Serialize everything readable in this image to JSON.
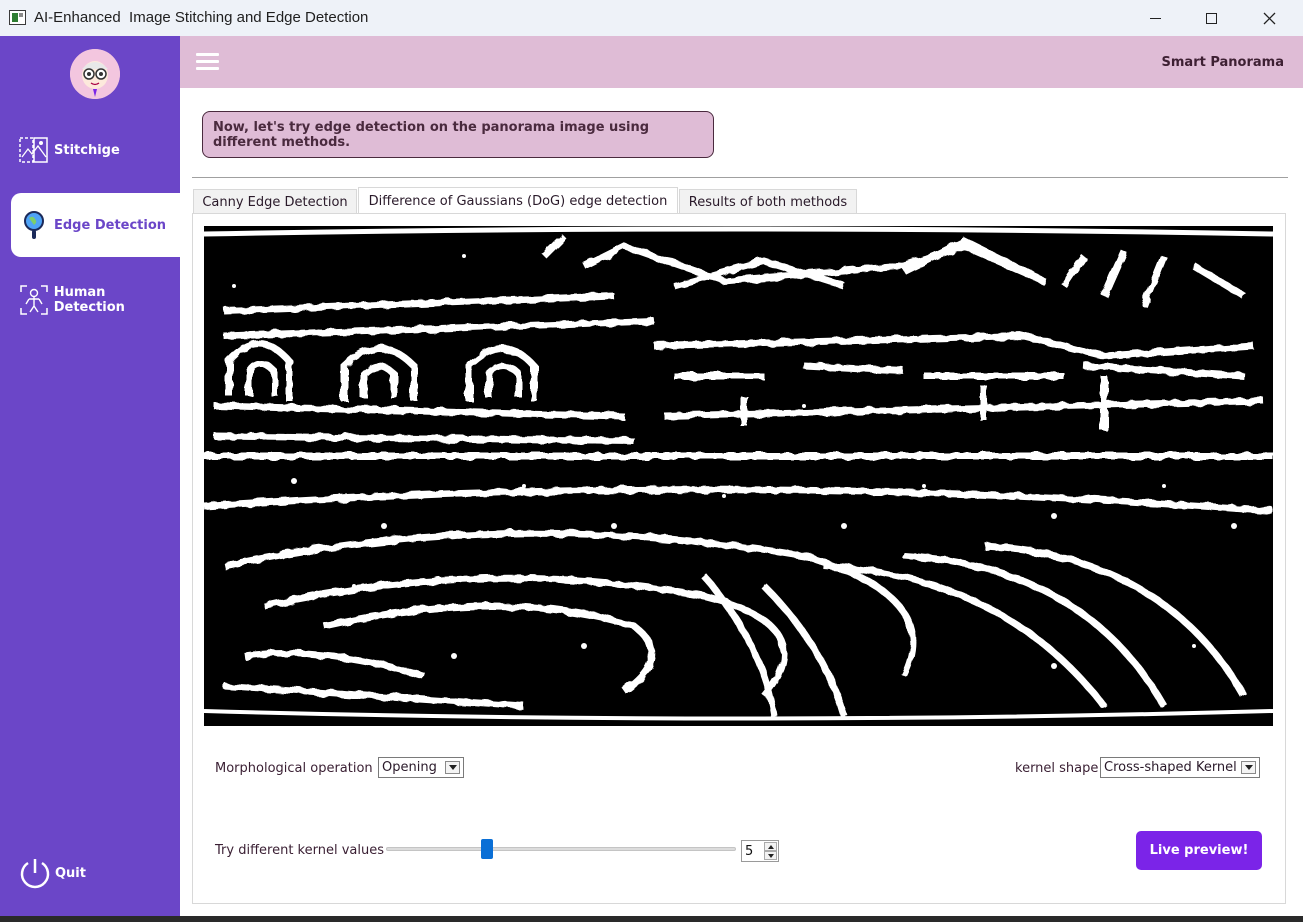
{
  "window": {
    "title": "AI-Enhanced  Image Stitching and Edge Detection"
  },
  "sidebar": {
    "items": [
      {
        "label": "Stitchige",
        "icon": "image-stitch-icon",
        "active": false
      },
      {
        "label": "Edge Detection",
        "icon": "magnifier-globe-icon",
        "active": true
      },
      {
        "label": "Human Detection",
        "icon": "human-scan-icon",
        "active": false
      }
    ],
    "quit_label": "Quit"
  },
  "header": {
    "title": "Smart Panorama"
  },
  "main": {
    "message": "Now, let's try edge detection on the panorama image using different methods.",
    "tabs": [
      {
        "label": "Canny Edge Detection",
        "active": false
      },
      {
        "label": "Difference of Gaussians (DoG) edge detection",
        "active": true
      },
      {
        "label": "Results of both methods",
        "active": false
      }
    ],
    "controls": {
      "morph_label": "Morphological operation",
      "morph_value": "Opening",
      "kernel_shape_label": "kernel shape",
      "kernel_shape_value": "Cross-shaped Kernel",
      "kernel_values_label": "Try different kernel values",
      "kernel_value": "5",
      "live_preview_label": "Live preview!"
    }
  },
  "colors": {
    "sidebar": "#6b46c8",
    "header": "#dfbcd6",
    "accent_button": "#7b24e8",
    "slider_handle": "#0a6fd6"
  }
}
